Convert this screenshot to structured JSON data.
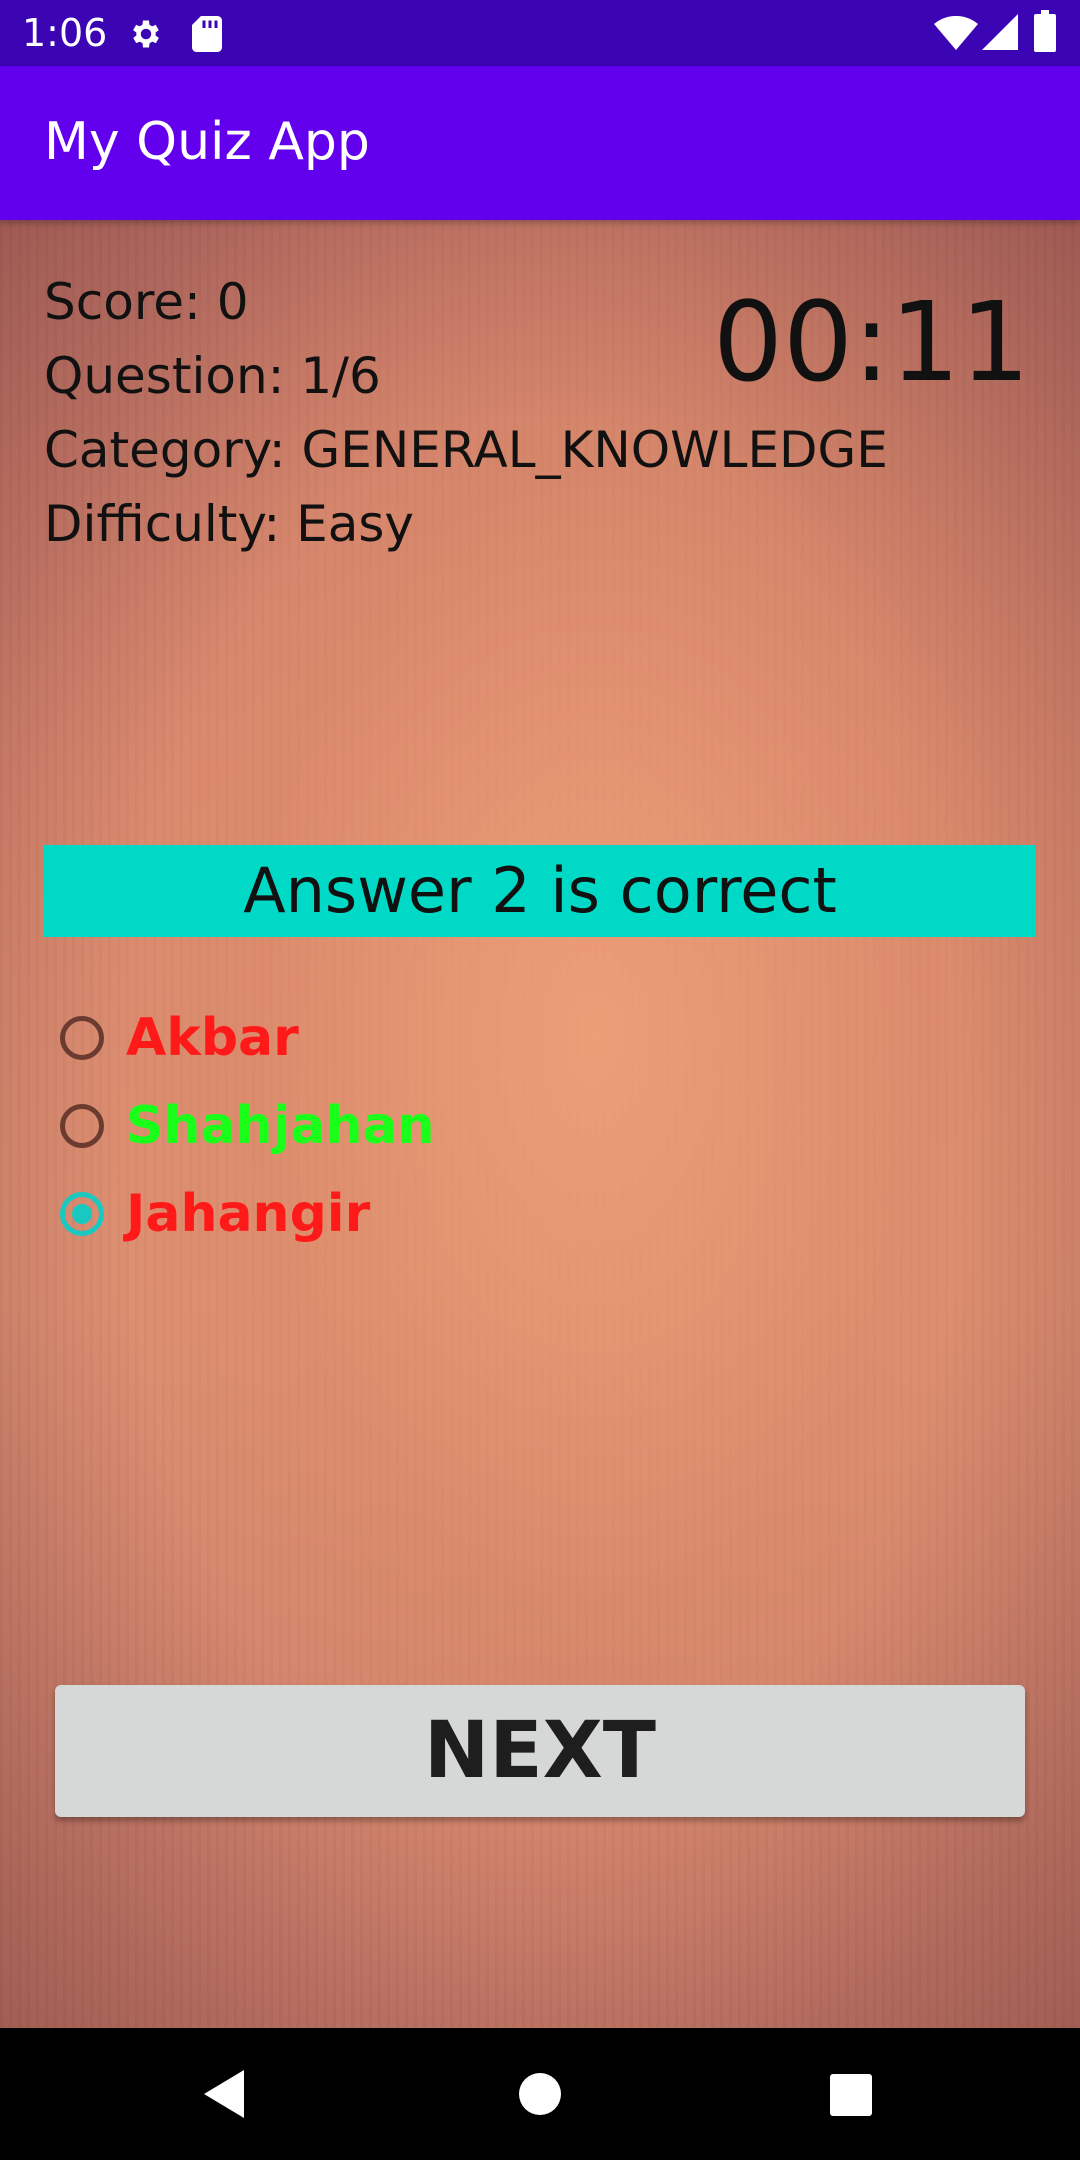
{
  "status_bar": {
    "time": "1:06",
    "icons": [
      "gear-icon",
      "sd-card-icon",
      "wifi-icon",
      "signal-icon",
      "battery-icon"
    ]
  },
  "app_bar": {
    "title": "My Quiz App",
    "color": "#6200ee"
  },
  "quiz": {
    "score": "Score: 0",
    "question": "Question: 1/6",
    "category": "Category: GENERAL_KNOWLEDGE",
    "difficulty": "Difficulty: Easy",
    "timer": "00:11",
    "result": "Answer 2 is correct",
    "result_color": "#00d9c5",
    "options": [
      {
        "label": "Akbar",
        "color": "#ff1a1a",
        "checked": false
      },
      {
        "label": "Shahjahan",
        "color": "#1aff1a",
        "checked": false
      },
      {
        "label": "Jahangir",
        "color": "#ff1a1a",
        "checked": true
      }
    ],
    "next_label": "NEXT"
  },
  "nav_bar": {
    "icons": [
      "back-icon",
      "home-icon",
      "recents-icon"
    ]
  }
}
